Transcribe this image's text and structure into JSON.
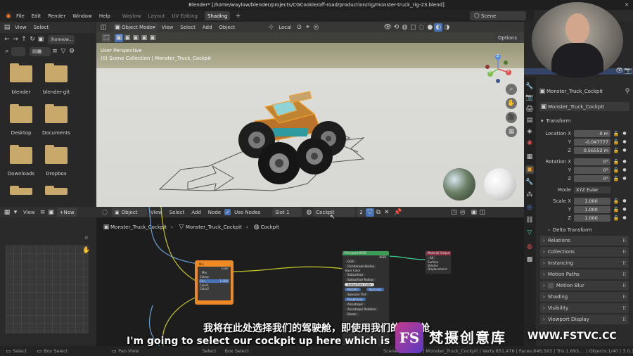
{
  "titlebar": {
    "title": "Blender* [/home/waylow/blender/projects/CGCookie/off-road/production/rig/monster-truck_rig-23.blend]"
  },
  "topbar": {
    "menus": [
      "File",
      "Edit",
      "Render",
      "Window",
      "Help"
    ],
    "workspaces": [
      "Waylow",
      "Layout",
      "UV Editing",
      "Shading"
    ],
    "active_workspace": "Shading",
    "scene": "Scene"
  },
  "filebrowser": {
    "menus": [
      "View",
      "Select"
    ],
    "path": "/home/w...",
    "items": [
      {
        "name": "blender",
        "type": "folder"
      },
      {
        "name": "blender-git",
        "type": "folder"
      },
      {
        "name": "Desktop",
        "type": "folder"
      },
      {
        "name": "Documents",
        "type": "folder-doc"
      },
      {
        "name": "Downloads",
        "type": "folder-down"
      },
      {
        "name": "Dropbox",
        "type": "folder"
      }
    ]
  },
  "viewport": {
    "mode": "Object Mode",
    "menus": [
      "View",
      "Select",
      "Add",
      "Object"
    ],
    "orientation": "Local",
    "options_label": "Options",
    "perspective": "User Perspective",
    "collection": "(0) Scene Collection | Monster_Truck_Cockpit",
    "gizmo_labels": {
      "x": "X",
      "y": "Y",
      "z": "Z"
    }
  },
  "image_editor": {
    "menus": [
      "View"
    ],
    "new_label": "New"
  },
  "node_editor": {
    "type_label": "Object",
    "menus": [
      "View",
      "Select",
      "Add",
      "Node"
    ],
    "use_nodes": "Use Nodes",
    "slot": "Slot 1",
    "material": "Cockpit",
    "users": "2",
    "breadcrumb": [
      "Monster_Truck_Cockpit",
      "Monster_Truck_Cockpit",
      "Cockpit"
    ],
    "nodes": {
      "mix": {
        "title": "Mix",
        "rows": [
          "Color",
          "Mix",
          "Clamp",
          "Fac",
          "Color1",
          "Color2"
        ],
        "fac": "1.000"
      },
      "bsdf": {
        "title": "Principled BSDF",
        "top": "BSDF",
        "rows": [
          "GGX",
          "Christensen-Burley",
          "Base Color",
          "Subsurface",
          "Subsurface Radius",
          "Subsurface Color",
          "Metallic",
          "Specular",
          "Specular Tint",
          "Roughness",
          "Anisotropic",
          "Anisotropic Rotation",
          "Sheen"
        ]
      },
      "output": {
        "title": "Material Output",
        "rows": [
          "All",
          "Surface",
          "Volume",
          "Displacement"
        ]
      }
    }
  },
  "properties": {
    "object_name": "Monster_Truck_Cockpit",
    "data_name": "Monster_Truck_Cockpit",
    "transform_label": "Transform",
    "location_label": "Location X",
    "location": [
      "-0 m",
      "-0.047777",
      "0.56552 m"
    ],
    "rotation_label": "Rotation X",
    "rotation": [
      "0°",
      "0°",
      "0°"
    ],
    "mode_label": "Mode",
    "mode": "XYZ Euler",
    "scale_label": "Scale X",
    "scale": [
      "1.000",
      "1.000",
      "1.000"
    ],
    "axis_y": "Y",
    "axis_z": "Z",
    "panels": [
      "Delta Transform",
      "Relations",
      "Collections",
      "Instancing",
      "Motion Paths",
      "Motion Blur",
      "Shading",
      "Visibility",
      "Viewport Display"
    ]
  },
  "statusbar": {
    "items": [
      "Select",
      "Box Select",
      "Pan View",
      "Select",
      "Box Select"
    ],
    "stats": "Scene Collection | Monster_Truck_Cockpit | Verts:851,476 | Faces:846,593 | Tris:1,693,... | Objects:1/40 | 3.0.1"
  },
  "subtitles": {
    "chinese": "我将在此处选择我们的驾驶舱，即使用我们的驾驶舱",
    "english": "I'm going to select our cockpit up here which is"
  },
  "watermark": {
    "logo": "FS",
    "text": "梵摄创意库",
    "url": "WWW.FSTVC.CC"
  },
  "colors": {
    "accent": "#4772b3",
    "selected_node": "#e8872a",
    "mix_node": "#f08a24",
    "shader_header": "#3d9b58",
    "output_header": "#8a3443",
    "link_yellow": "#c7c729"
  }
}
